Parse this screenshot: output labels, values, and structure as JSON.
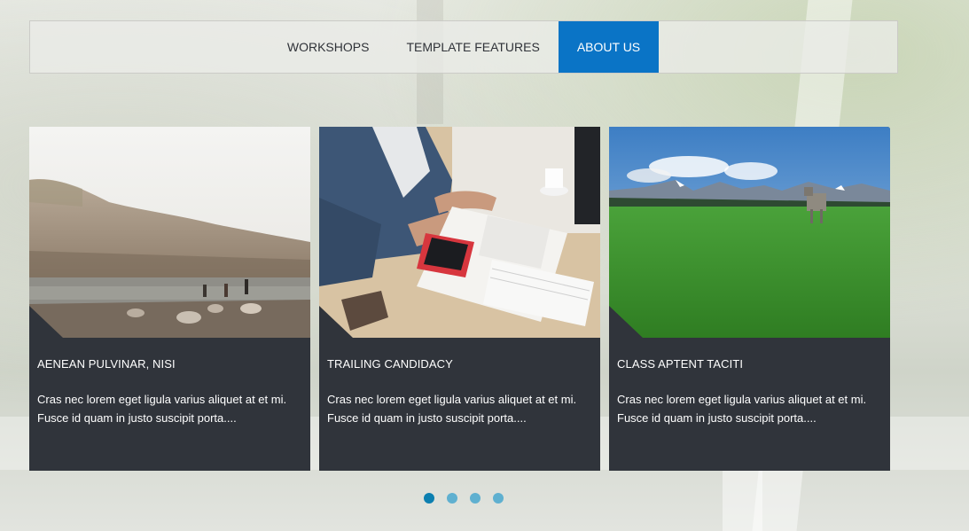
{
  "nav": {
    "items": [
      {
        "label": "WORKSHOPS",
        "active": false
      },
      {
        "label": "TEMPLATE FEATURES",
        "active": false
      },
      {
        "label": "ABOUT US",
        "active": true
      }
    ],
    "active_color": "#0a74c6"
  },
  "cards": [
    {
      "title": "AENEAN PULVINAR, NISI",
      "text": "Cras nec lorem eget ligula varius aliquet at et mi. Fusce id quam in justo suscipit porta....",
      "image": "lake-shore-photo"
    },
    {
      "title": "TRAILING CANDIDACY",
      "text": "Cras nec lorem eget ligula varius aliquet at et mi. Fusce id quam in justo suscipit porta....",
      "image": "business-desk-photo"
    },
    {
      "title": "CLASS APTENT TACITI",
      "text": "Cras nec lorem eget ligula varius aliquet at et mi. Fusce id quam in justo suscipit porta....",
      "image": "mountain-meadow-cow-photo"
    }
  ],
  "carousel": {
    "dot_count": 4,
    "active_index": 0,
    "dot_color": "#5fb0d0",
    "active_dot_color": "#0c7fb0"
  },
  "card_background": "#30343b"
}
